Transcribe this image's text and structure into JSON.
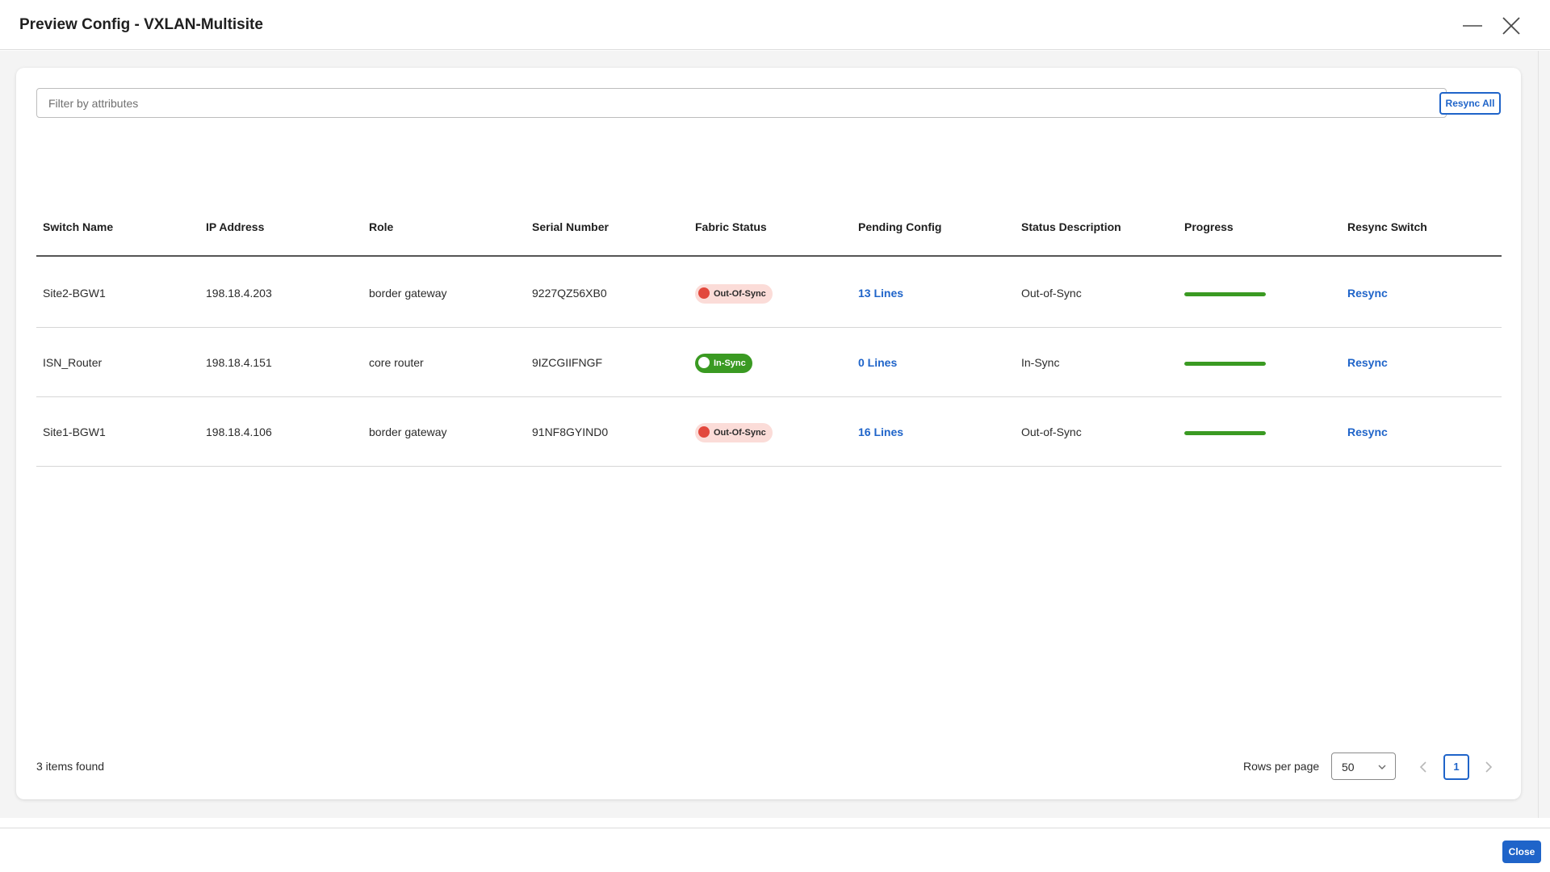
{
  "dialog": {
    "title": "Preview Config - VXLAN-Multisite",
    "minimize_icon": "minus-icon",
    "close_icon": "close-x-icon"
  },
  "filter": {
    "placeholder": "Filter by attributes",
    "value": ""
  },
  "toolbar": {
    "resync_all_label": "Resync All"
  },
  "table": {
    "columns": [
      "Switch Name",
      "IP Address",
      "Role",
      "Serial Number",
      "Fabric Status",
      "Pending Config",
      "Status Description",
      "Progress",
      "Resync Switch"
    ],
    "rows": [
      {
        "switch_name": "Site2-BGW1",
        "ip": "198.18.4.203",
        "role": "border gateway",
        "serial": "9227QZ56XB0",
        "fabric_status": "Out-Of-Sync",
        "fabric_state": "out",
        "pending": "13 Lines",
        "desc": "Out-of-Sync",
        "progress": 1.0,
        "resync": "Resync"
      },
      {
        "switch_name": "ISN_Router",
        "ip": "198.18.4.151",
        "role": "core router",
        "serial": "9IZCGIIFNGF",
        "fabric_status": "In-Sync",
        "fabric_state": "in",
        "pending": "0 Lines",
        "desc": "In-Sync",
        "progress": 1.0,
        "resync": "Resync"
      },
      {
        "switch_name": "Site1-BGW1",
        "ip": "198.18.4.106",
        "role": "border gateway",
        "serial": "91NF8GYIND0",
        "fabric_status": "Out-Of-Sync",
        "fabric_state": "out",
        "pending": "16 Lines",
        "desc": "Out-of-Sync",
        "progress": 1.0,
        "resync": "Resync"
      }
    ]
  },
  "pagination": {
    "items_found": "3 items found",
    "rows_per_page_label": "Rows per page",
    "rows_per_page_value": "50",
    "current_page": "1",
    "prev_icon": "chevron-left-icon",
    "next_icon": "chevron-right-icon"
  },
  "footer": {
    "close_label": "Close"
  },
  "colors": {
    "accent": "#1f64c9",
    "in_sync": "#3a9a22",
    "out_of_sync_dot": "#e2483d",
    "out_of_sync_bg": "#fbdcd8",
    "progress": "#3a9a22"
  }
}
